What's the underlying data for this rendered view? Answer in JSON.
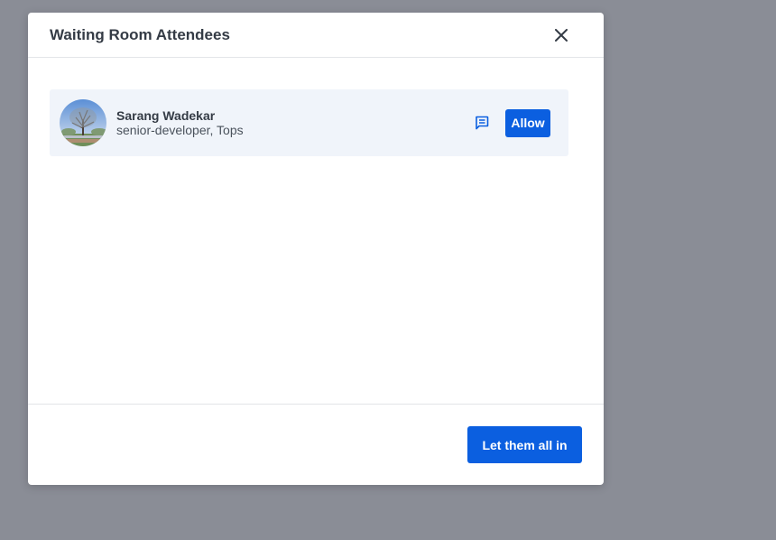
{
  "modal": {
    "title": "Waiting Room Attendees"
  },
  "attendees": [
    {
      "name": "Sarang Wadekar",
      "role": "senior-developer, Tops",
      "allow_label": "Allow",
      "chat_icon": "chat-message-icon"
    }
  ],
  "footer": {
    "let_all_in_label": "Let them all in"
  },
  "icons": {
    "close": "close-icon",
    "chat": "chat-message-icon"
  },
  "colors": {
    "backdrop": "#8a8d96",
    "accent": "#0b5fe0",
    "row_background": "#f0f4fa",
    "title_text": "#343b45"
  }
}
